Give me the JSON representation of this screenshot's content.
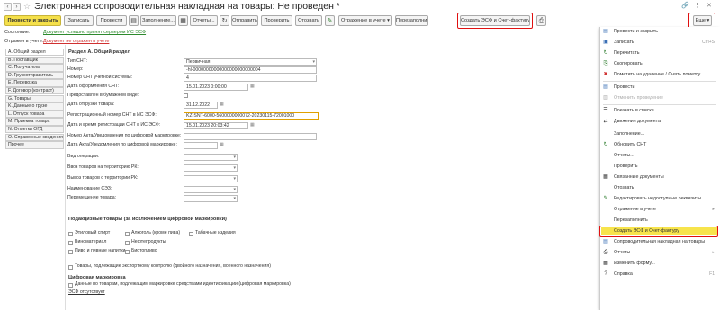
{
  "window": {
    "title": "Электронная сопроводительная накладная на товары: Не проведен *",
    "link_icon": "link-icon",
    "more_icon": "ellipsis-icon",
    "close_icon": "close-icon"
  },
  "toolbar": {
    "post_close": "Провести и закрыть",
    "save": "Записать",
    "post": "Провести",
    "fill": "Заполнение...",
    "reports": "Отчеты...",
    "send": "Отправить",
    "check": "Проверить",
    "revoke": "Отозвать",
    "reflect": "Отражение в учете",
    "refill": "Перезаполнить",
    "create_esf": "Создать ЭСФ и Счет-фактуру",
    "more": "Еще"
  },
  "status": {
    "state_label": "Состояние:",
    "state_value": "Документ успешно принят сервером ИС ЭСФ",
    "reflect_label": "Отражен в учете:",
    "reflect_value": "Документ не отражен в учете"
  },
  "sidebar": {
    "tabs": [
      "A. Общий раздел",
      "B. Поставщик",
      "C. Получатель",
      "D. Грузоотправитель",
      "E. Перевозка",
      "F. Договор (контракт)",
      "G. Товары",
      "K. Данные о грузе",
      "L. Отпуск товара",
      "M. Приемка товара",
      "N. Отметки ОГД",
      "O. Справочные сведения",
      "Прочее"
    ]
  },
  "form": {
    "section": "Раздел A. Общий раздел",
    "fields": [
      {
        "label": "Тип СНТ:",
        "value": "Первичная"
      },
      {
        "label": "Номер:",
        "value": "-hl-00000000000000000000000004"
      },
      {
        "label": "Номер СНТ учетной системы:",
        "value": "4"
      },
      {
        "label": "Дата оформления СНТ:",
        "value": "15.01.2023 0:00:00"
      },
      {
        "label": "Предоставлен в бумажном виде:",
        "value": ""
      },
      {
        "label": "Дата отгрузки товара:",
        "value": "31.12.2022"
      },
      {
        "label": "Регистрационный номер СНТ в ИС ЭСФ:",
        "value": "KZ-SNT-6000-5600000000072-20230115-72001000"
      },
      {
        "label": "Дата и время регистрации СНТ в ИС ЭСФ:",
        "value": "15.01.2023 20:03:42"
      },
      {
        "label": "Номер Акта/Уведомления по цифровой маркировке:",
        "value": ""
      },
      {
        "label": "Дата Акта/Уведомления по цифровой маркировке:",
        "value": ". ."
      },
      {
        "label": "Вид операции:",
        "value": ""
      },
      {
        "label": "Ввоз товаров на территорию РК:",
        "value": ""
      },
      {
        "label": "Вывоз товаров с территории РК:",
        "value": ""
      },
      {
        "label": "Наименование СЭЗ:",
        "value": ""
      },
      {
        "label": "Перемещение товара:",
        "value": ""
      }
    ],
    "excise_header": "Подакцизные товары (за исключением цифровой маркировки)",
    "excise_items": [
      "Этиловый спирт",
      "Алкоголь (кроме пива)",
      "Табачные изделия",
      "Виноматериал",
      "Нефтепродукты",
      "Пиво и пивные напитки",
      "Биотопливо"
    ],
    "dual_use": "Товары, подлежащие экспортному контролю (двойного назначения, военного назначения)",
    "digital_header": "Цифровая маркировка",
    "digital_item": "Данные по товарам, подлежащим маркировке средствами идентификации (цифровая маркировка)",
    "esf_missing": "ЭСФ отсутствует"
  },
  "menu": {
    "items": [
      {
        "icon": "post-close-icon",
        "glyph": "▤",
        "label": "Провести и закрыть",
        "shortcut": ""
      },
      {
        "icon": "save-icon",
        "glyph": "▣",
        "label": "Записать",
        "shortcut": "Ctrl+S"
      },
      {
        "icon": "reread-icon",
        "glyph": "↻",
        "label": "Перечитать",
        "shortcut": ""
      },
      {
        "icon": "copy-icon",
        "glyph": "⎘",
        "label": "Скопировать",
        "shortcut": ""
      },
      {
        "icon": "delete-mark-icon",
        "glyph": "✖",
        "label": "Пометить на удаление / Снять пометку",
        "shortcut": ""
      },
      {
        "icon": "post-icon",
        "glyph": "▤",
        "label": "Провести",
        "shortcut": ""
      },
      {
        "icon": "unpost-icon",
        "glyph": "▥",
        "label": "Отменить проведение",
        "shortcut": ""
      },
      {
        "icon": "show-in-list-icon",
        "glyph": "☰",
        "label": "Показать в списке",
        "shortcut": ""
      },
      {
        "icon": "movements-icon",
        "glyph": "⇄",
        "label": "Движения документа",
        "shortcut": ""
      },
      {
        "icon": "",
        "glyph": "",
        "label": "Заполнение...",
        "shortcut": ""
      },
      {
        "icon": "refresh-icon",
        "glyph": "↻",
        "label": "Обновить СНТ",
        "shortcut": ""
      },
      {
        "icon": "",
        "glyph": "",
        "label": "Отчеты...",
        "shortcut": ""
      },
      {
        "icon": "",
        "glyph": "",
        "label": "Проверить",
        "shortcut": ""
      },
      {
        "icon": "linked-docs-icon",
        "glyph": "▦",
        "label": "Связанные документы",
        "shortcut": ""
      },
      {
        "icon": "",
        "glyph": "",
        "label": "Отозвать",
        "shortcut": ""
      },
      {
        "icon": "edit-icon",
        "glyph": "✎",
        "label": "Редактировать недоступные реквизиты",
        "shortcut": ""
      },
      {
        "icon": "",
        "glyph": "",
        "label": "Отражение в учете",
        "shortcut": "▸"
      },
      {
        "icon": "",
        "glyph": "",
        "label": "Перезаполнить",
        "shortcut": ""
      },
      {
        "icon": "",
        "glyph": "",
        "label": "Создать ЭСФ и Счет-фактуру",
        "shortcut": ""
      },
      {
        "icon": "waybill-icon",
        "glyph": "▤",
        "label": "Сопроводительная накладная на товары",
        "shortcut": ""
      },
      {
        "icon": "print-icon",
        "glyph": "⎙",
        "label": "Отчеты",
        "shortcut": "▸"
      },
      {
        "icon": "form-icon",
        "glyph": "▦",
        "label": "Изменить форму...",
        "shortcut": ""
      },
      {
        "icon": "help-icon",
        "glyph": "?",
        "label": "Справка",
        "shortcut": "F1"
      }
    ]
  },
  "colors": {
    "accent_yellow": "#f5e04a",
    "highlight_red": "#e01010",
    "link_green": "#2d8a2d",
    "link_red": "#d03030"
  }
}
